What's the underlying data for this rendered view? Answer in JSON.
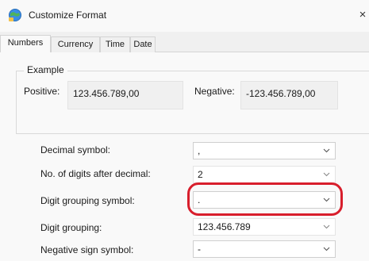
{
  "window": {
    "title": "Customize Format",
    "close_glyph": "×"
  },
  "tabs": [
    {
      "label": "Numbers",
      "active": true
    },
    {
      "label": "Currency",
      "active": false
    },
    {
      "label": "Time",
      "active": false
    },
    {
      "label": "Date",
      "active": false
    }
  ],
  "example": {
    "title": "Example",
    "positive_label": "Positive:",
    "positive_value": "123.456.789,00",
    "negative_label": "Negative:",
    "negative_value": "-123.456.789,00"
  },
  "settings": [
    {
      "label": "Decimal symbol:",
      "value": ","
    },
    {
      "label": "No. of digits after decimal:",
      "value": "2"
    },
    {
      "label": "Digit grouping symbol:",
      "value": "."
    },
    {
      "label": "Digit grouping:",
      "value": "123.456.789"
    },
    {
      "label": "Negative sign symbol:",
      "value": "-"
    }
  ],
  "colors": {
    "highlight": "#d81e2c",
    "background": "#f9f9f9"
  },
  "icons": {
    "title": "region-globe-icon",
    "dropdown": "chevron-down-icon"
  }
}
